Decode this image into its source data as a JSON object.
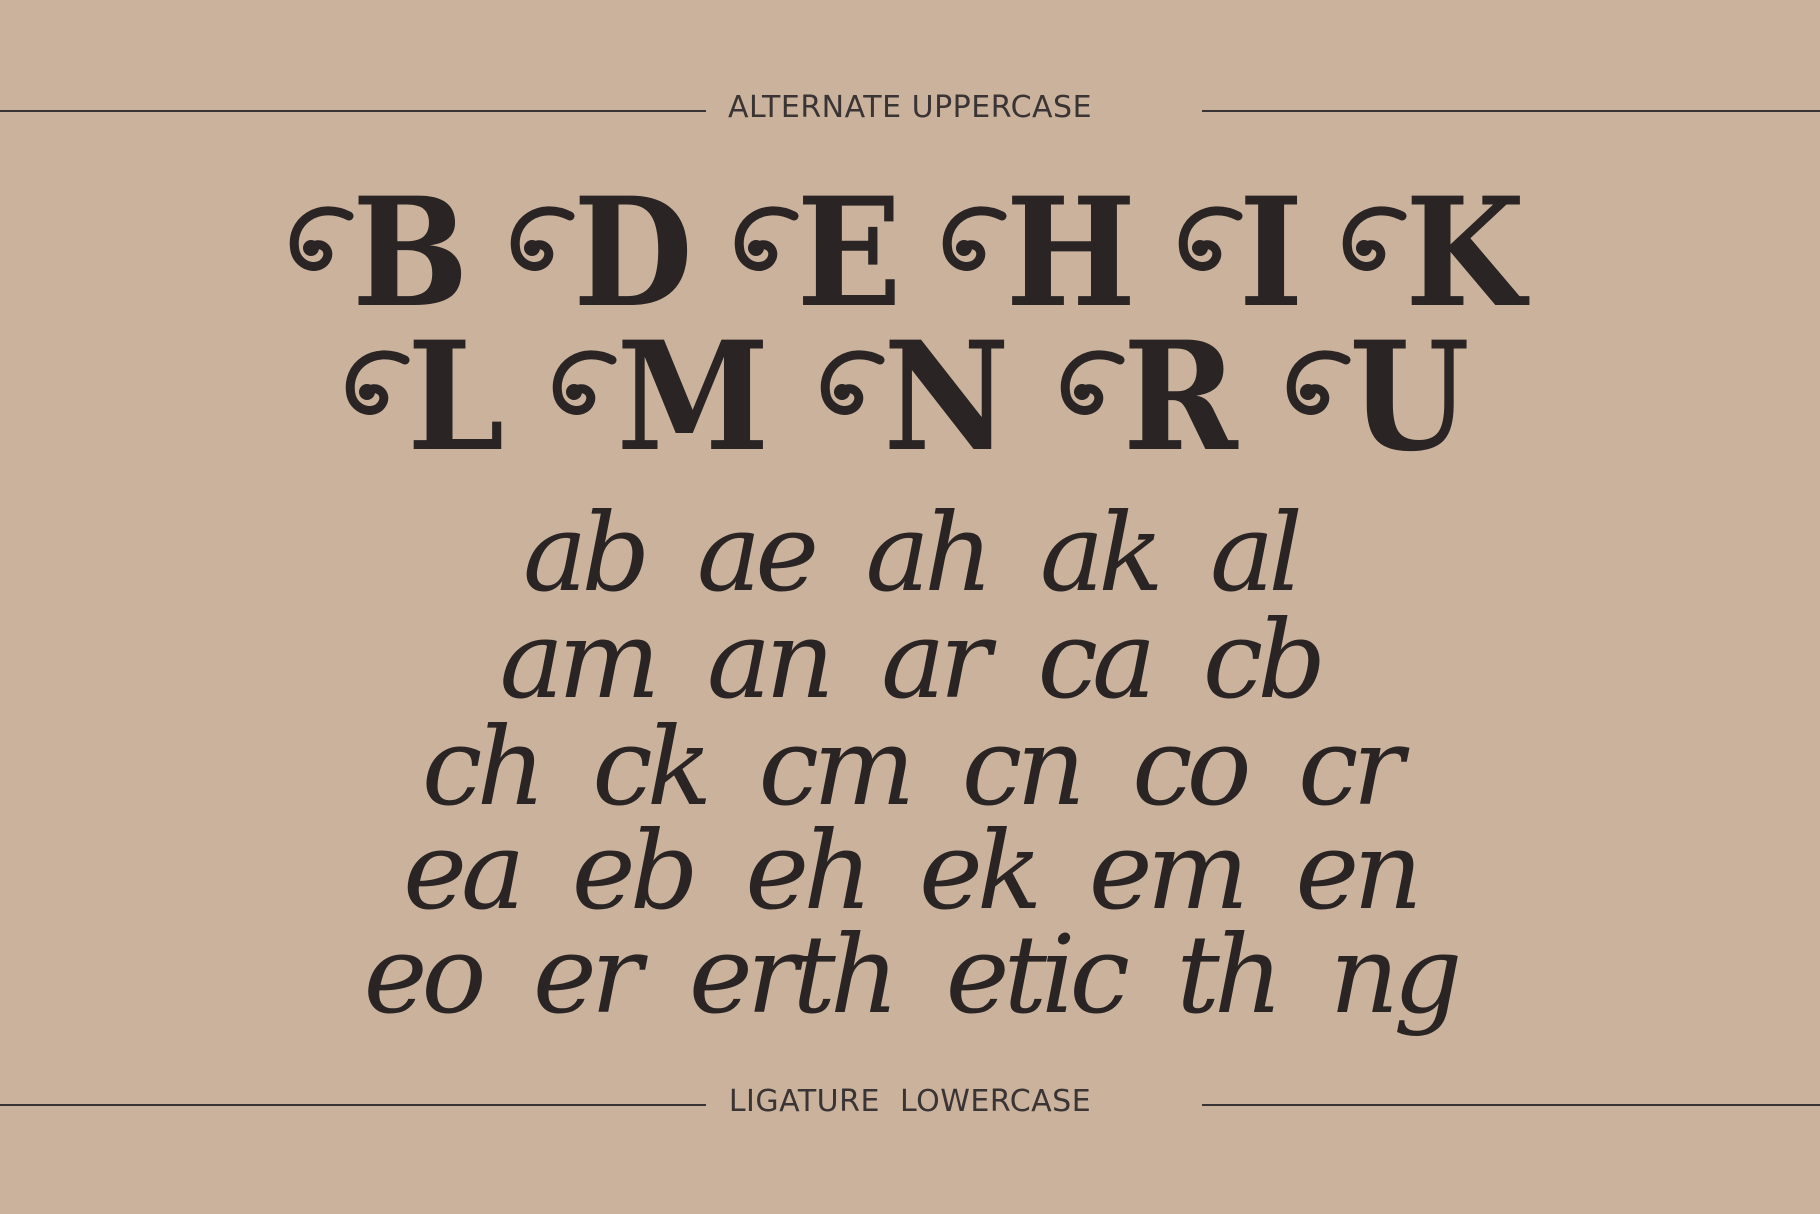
{
  "sections": {
    "top_label": "ALTERNATE UPPERCASE",
    "bottom_label": "LIGATURE  LOWERCASE"
  },
  "uppercase": {
    "row1": [
      "B",
      "D",
      "E",
      "H",
      "I",
      "K"
    ],
    "row2": [
      "L",
      "M",
      "N",
      "R",
      "U"
    ]
  },
  "ligatures": {
    "row1": [
      "ab",
      "ae",
      "ah",
      "ak",
      "al"
    ],
    "row2": [
      "am",
      "an",
      "ar",
      "ca",
      "cb"
    ],
    "row3": [
      "ch",
      "ck",
      "cm",
      "cn",
      "co",
      "cr"
    ],
    "row4": [
      "ea",
      "eb",
      "eh",
      "ek",
      "em",
      "en"
    ],
    "row5": [
      "eo",
      "er",
      "erth",
      "etic",
      "th",
      "ng"
    ]
  },
  "colors": {
    "background": "#cab29c",
    "ink": "#2a2424",
    "rule": "#3a3434"
  }
}
